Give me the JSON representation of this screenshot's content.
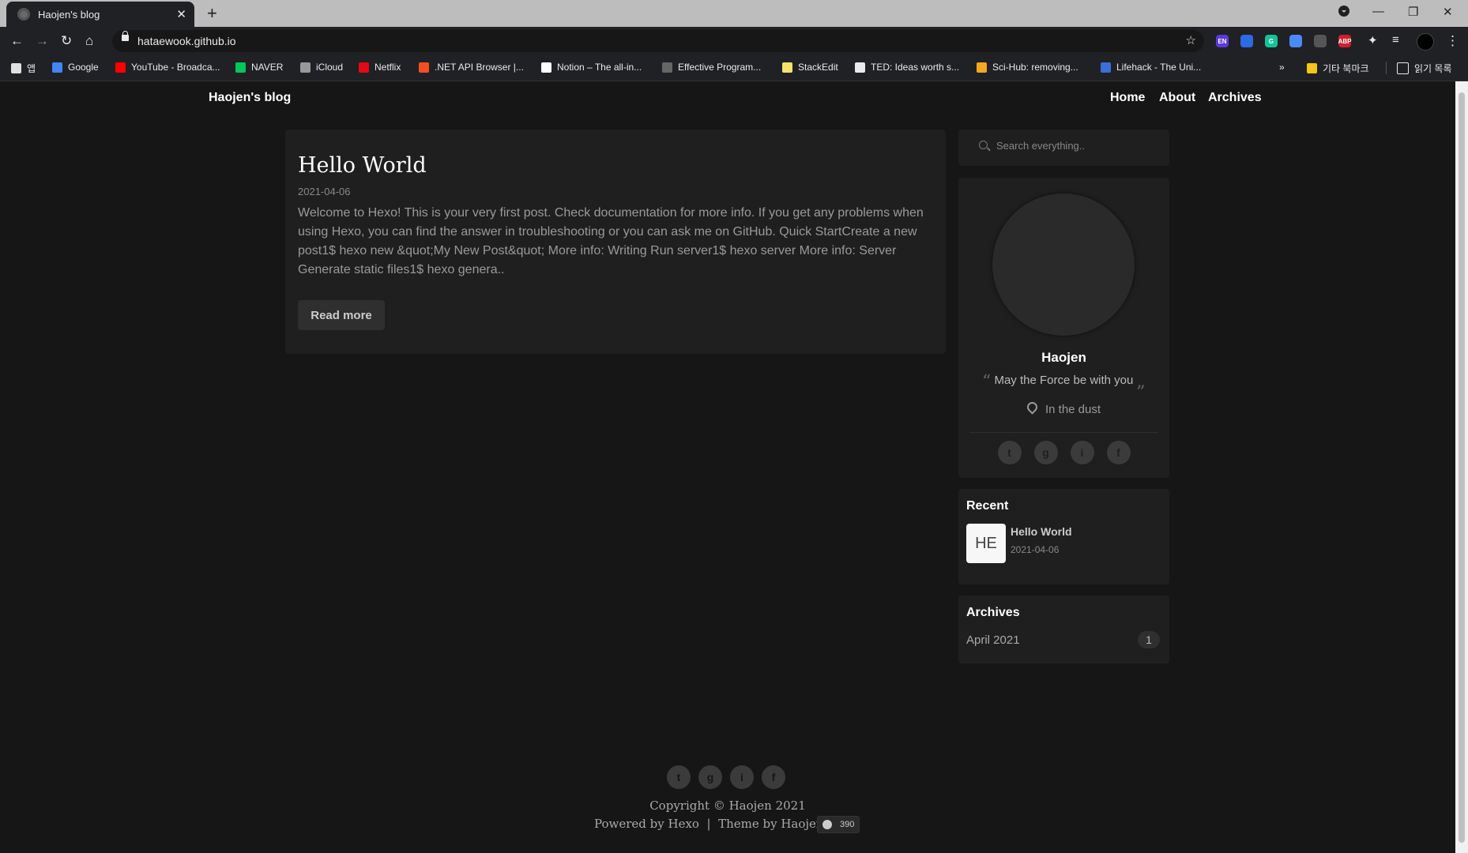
{
  "browser": {
    "tab_title": "Haojen's blog",
    "url": "hataewook.github.io",
    "extensions": [
      {
        "name": "en-extension-icon",
        "label": "EN",
        "color": "#5c3bd6"
      },
      {
        "name": "shield-extension-icon",
        "label": "",
        "color": "#2d6be6"
      },
      {
        "name": "grammarly-icon",
        "label": "G",
        "color": "#15c39a"
      },
      {
        "name": "pin-extension-icon",
        "label": "",
        "color": "#4a8cf7"
      },
      {
        "name": "window-extension-icon",
        "label": "",
        "color": "#555"
      },
      {
        "name": "adblock-icon",
        "label": "ABP",
        "color": "#d21f2c"
      }
    ],
    "bookmarks": [
      {
        "label": "앱",
        "color": "#e0e0e0"
      },
      {
        "label": "Google",
        "color": "#4285f4"
      },
      {
        "label": "YouTube - Broadca...",
        "color": "#ff0000"
      },
      {
        "label": "NAVER",
        "color": "#03c75a"
      },
      {
        "label": "iCloud",
        "color": "#999999"
      },
      {
        "label": "Netflix",
        "color": "#e50914"
      },
      {
        "label": ".NET API Browser |...",
        "color": "#f25022"
      },
      {
        "label": "Notion – The all-in...",
        "color": "#ffffff"
      },
      {
        "label": "Effective Program...",
        "color": "#666666"
      },
      {
        "label": "StackEdit",
        "color": "#f7e36b"
      },
      {
        "label": "TED: Ideas worth s...",
        "color": "#e8eaed"
      },
      {
        "label": "Sci-Hub: removing...",
        "color": "#f5a623"
      },
      {
        "label": "Lifehack - The Uni...",
        "color": "#3b6fd6"
      }
    ],
    "other_bookmarks": "기타 북마크",
    "reading_list": "읽기 목록",
    "more_bookmarks": "»"
  },
  "site": {
    "brand": "Haojen's blog",
    "nav": [
      "Home",
      "About",
      "Archives"
    ]
  },
  "post": {
    "title": "Hello World",
    "date": "2021-04-06",
    "excerpt": "Welcome to Hexo! This is your very first post. Check documentation for more info. If you get any problems when using Hexo, you can find the answer in troubleshooting or you can ask me on GitHub. Quick StartCreate a new post1$ hexo new &quot;My New Post&quot; More info: Writing Run server1$ hexo server More info: Server Generate static files1$ hexo genera..",
    "read_more": "Read more"
  },
  "search": {
    "placeholder": "Search everything.."
  },
  "profile": {
    "name": "Haojen",
    "quote_open": "“",
    "bio": "May the Force be with you",
    "quote_close": "„",
    "location": "In the dust",
    "social_glyphs": {
      "twitter": "t",
      "github": "g",
      "instagram": "i",
      "facebook": "f"
    }
  },
  "recent": {
    "title": "Recent",
    "items": [
      {
        "thumb": "HE",
        "title": "Hello World",
        "date": "2021-04-06"
      }
    ]
  },
  "archives": {
    "title": "Archives",
    "items": [
      {
        "label": "April 2021",
        "count": "1"
      }
    ]
  },
  "footer": {
    "copyright": "Copyright © Haojen 2021",
    "powered": "Powered by Hexo  |  Theme by Haojen",
    "stars": "390"
  }
}
